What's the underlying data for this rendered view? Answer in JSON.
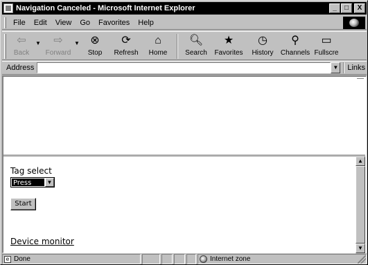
{
  "window": {
    "title": "Navigation Canceled - Microsoft Internet Explorer",
    "minimize": "_",
    "maximize": "□",
    "close": "X"
  },
  "menu": {
    "file": "File",
    "edit": "Edit",
    "view": "View",
    "go": "Go",
    "favorites": "Favorites",
    "help": "Help"
  },
  "toolbar": {
    "back": "Back",
    "forward": "Forward",
    "stop": "Stop",
    "refresh": "Refresh",
    "home": "Home",
    "search": "Search",
    "favorites": "Favorites",
    "history": "History",
    "channels": "Channels",
    "fullscreen": "Fullscre"
  },
  "address": {
    "label": "Address",
    "value": "",
    "links": "Links"
  },
  "page": {
    "tag_select_label": "Tag select",
    "tag_select_value": "Press",
    "start_button": "Start",
    "device_monitor_link": "Device monitor"
  },
  "status": {
    "text": "Done",
    "zone": "Internet zone"
  }
}
